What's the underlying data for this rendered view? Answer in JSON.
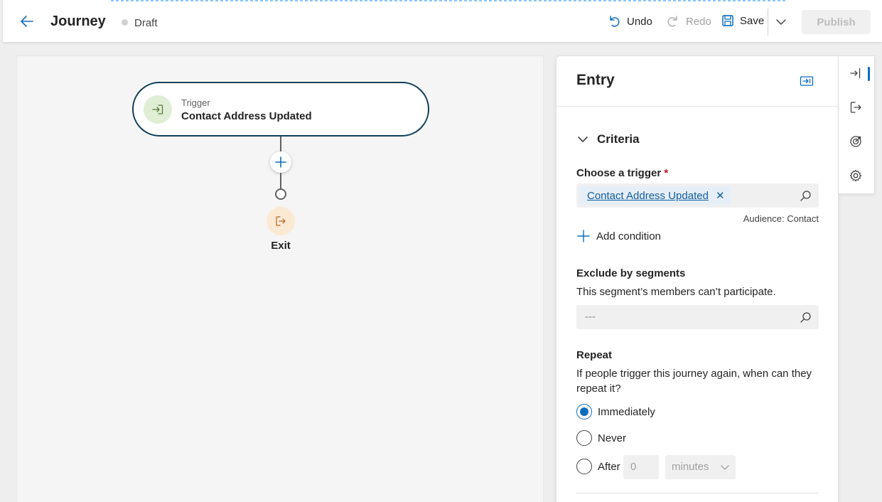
{
  "header": {
    "title": "Journey",
    "status": "Draft",
    "undo_label": "Undo",
    "redo_label": "Redo",
    "save_label": "Save",
    "publish_label": "Publish"
  },
  "canvas": {
    "trigger_node": {
      "label": "Trigger",
      "name": "Contact Address Updated",
      "icon": "enter-icon"
    },
    "add_step_icon": "plus-icon",
    "exit_node": {
      "label": "Exit",
      "icon": "exit-icon"
    }
  },
  "panel": {
    "title": "Entry",
    "criteria": {
      "title": "Criteria",
      "trigger_label": "Choose a trigger",
      "required_marker": "*",
      "trigger_value": "Contact Address Updated",
      "audience": "Audience: Contact",
      "add_condition": "Add condition"
    },
    "exclude": {
      "label": "Exclude by segments",
      "description": "This segment’s members can’t participate.",
      "placeholder": "---"
    },
    "repeat": {
      "label": "Repeat",
      "description": "If people trigger this journey again, when can they repeat it?",
      "options": [
        "Immediately",
        "Never",
        "After"
      ],
      "selected": "Immediately",
      "after_value": "0",
      "after_unit": "minutes"
    }
  },
  "rail": {
    "items": [
      "entry-icon",
      "exit-icon",
      "goal-icon",
      "settings-icon"
    ],
    "active": "entry-icon"
  },
  "colors": {
    "accent": "#0f6cbd",
    "node_border": "#0e3f5c",
    "trigger_bg": "#dfeed4",
    "exit_bg": "#fbe9d4"
  }
}
